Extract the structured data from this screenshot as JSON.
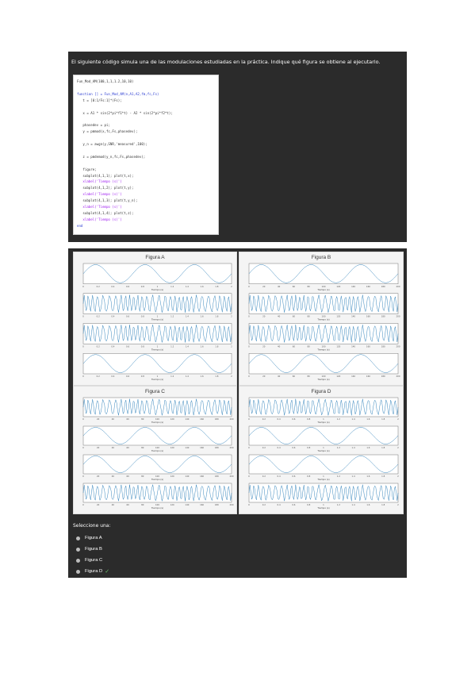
{
  "question": {
    "text": "El siguiente código simula una de las modulaciones estudiadas en la práctica. Indique qué figura se obtiene al ejecutarlo.",
    "code": [
      {
        "t": "Fun_Mod_AM(100,1,1,1.2,10,10)",
        "c": "n"
      },
      {
        "t": "",
        "c": "n"
      },
      {
        "t": "function [] = Fun_Mod_AM(n,A1,A2,fm,fc,Fs)",
        "c": "kw"
      },
      {
        "t": "   t = [0:1/Fs:1]*(Fs);",
        "c": "n"
      },
      {
        "t": "",
        "c": "n"
      },
      {
        "t": "   x = A1 * sin(2*pi*f1*t) - A2 * sin(2*pi*f2*t);",
        "c": "n"
      },
      {
        "t": "",
        "c": "n"
      },
      {
        "t": "   phasedev = pi;",
        "c": "n"
      },
      {
        "t": "   y = pmmod(x,fc,Fs,phasedev);",
        "c": "n"
      },
      {
        "t": "",
        "c": "n"
      },
      {
        "t": "   y_n = awgn(y,SNR,'measured',100);",
        "c": "n"
      },
      {
        "t": "",
        "c": "n"
      },
      {
        "t": "   z = pmdemod(y_n,fc,Fs,phasedev);",
        "c": "n"
      },
      {
        "t": "",
        "c": "n"
      },
      {
        "t": "   figure;",
        "c": "n"
      },
      {
        "t": "   subplot(4,1,1); plot(t,x);",
        "c": "n"
      },
      {
        "t": "   xlabel('Tiempo (s)')",
        "c": "str"
      },
      {
        "t": "   subplot(4,1,2); plot(t,y);",
        "c": "n"
      },
      {
        "t": "   xlabel('Tiempo (s)')",
        "c": "str"
      },
      {
        "t": "   subplot(4,1,3); plot(t,y_n);",
        "c": "n"
      },
      {
        "t": "   xlabel('Tiempo (s)')",
        "c": "str"
      },
      {
        "t": "   subplot(4,1,4); plot(t,z);",
        "c": "n"
      },
      {
        "t": "   xlabel('Tiempo (s)')",
        "c": "str"
      },
      {
        "t": "end",
        "c": "kw"
      }
    ]
  },
  "chart_data": [
    {
      "title": "Figura A",
      "type": "line",
      "xlabel": "Tiempo (s)",
      "xlim": [
        0,
        2
      ],
      "xticks": [
        "0",
        "0.2",
        "0.4",
        "0.6",
        "0.8",
        "1",
        "1.2",
        "1.4",
        "1.6",
        "1.8",
        "2"
      ],
      "order": [
        "sine",
        "pm",
        "pm",
        "sine"
      ]
    },
    {
      "title": "Figura B",
      "type": "line",
      "xlabel": "Tiempo (s)",
      "xlim": [
        0,
        200
      ],
      "xticks": [
        "0",
        "20",
        "40",
        "60",
        "80",
        "100",
        "120",
        "140",
        "160",
        "180",
        "200"
      ],
      "order": [
        "sine",
        "pm",
        "pm",
        "sine"
      ]
    },
    {
      "title": "Figura C",
      "type": "line",
      "xlabel": "Tiempo (s)",
      "xlim": [
        0,
        200
      ],
      "xticks": [
        "0",
        "20",
        "40",
        "60",
        "80",
        "100",
        "120",
        "140",
        "160",
        "180",
        "200"
      ],
      "order": [
        "pm",
        "sine",
        "sine",
        "pm"
      ]
    },
    {
      "title": "Figura D",
      "type": "line",
      "xlabel": "Tiempo (s)",
      "xlim": [
        0,
        2
      ],
      "xticks": [
        "0",
        "0.2",
        "0.4",
        "0.6",
        "0.8",
        "1",
        "1.2",
        "1.4",
        "1.6",
        "1.8",
        "2"
      ],
      "order": [
        "pm",
        "sine",
        "sine",
        "pm"
      ]
    }
  ],
  "answer": {
    "select_label": "Seleccione una:",
    "options": [
      {
        "label": "Figura A",
        "correct": false
      },
      {
        "label": "Figura B",
        "correct": false
      },
      {
        "label": "Figura C",
        "correct": false
      },
      {
        "label": "Figura D",
        "correct": true
      }
    ],
    "check_icon": "check-icon",
    "check_color": "#66bb6a"
  },
  "colors": {
    "panel_bg": "#2b2b2b",
    "plot_line": "#1f77b4"
  }
}
